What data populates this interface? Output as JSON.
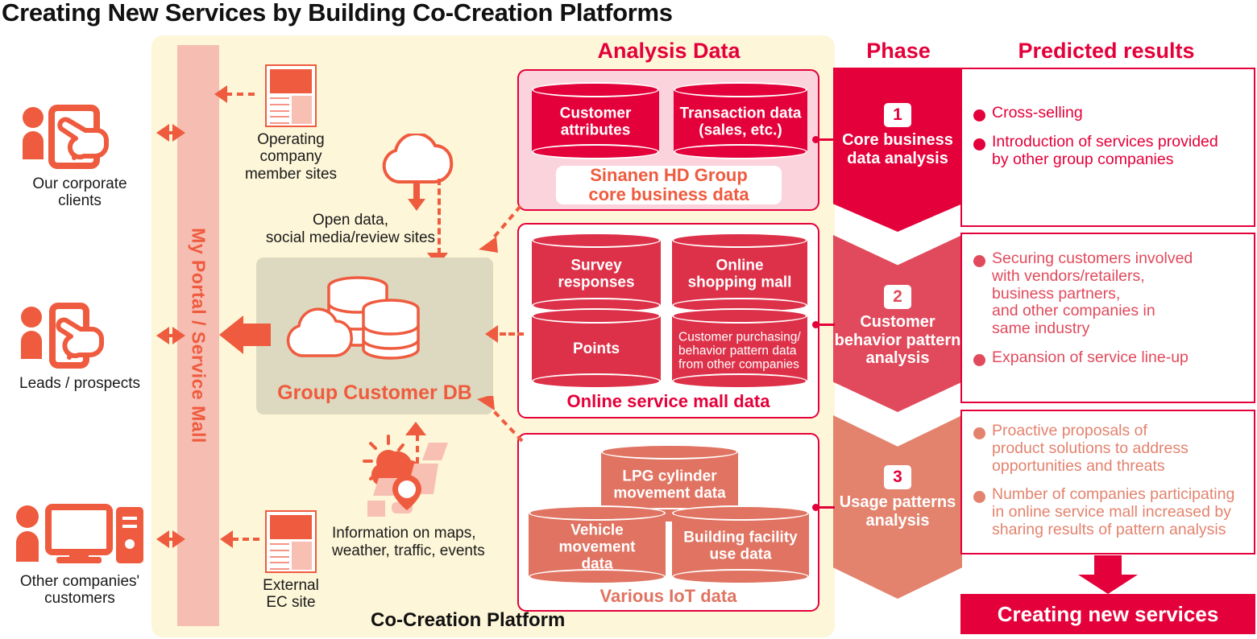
{
  "title": "Creating New Services by Building Co-Creation Platforms",
  "platform": {
    "label": "Co-Creation Platform",
    "portal_bar": "My Portal / Service Mall",
    "group_db": "Group Customer DB",
    "notes": {
      "open_data": "Open data,\nsocial media/review sites",
      "map_info": "Information on maps,\nweather, traffic, events"
    },
    "thumbs": [
      {
        "name": "operating-company-member-sites",
        "caption": "Operating company\nmember sites"
      },
      {
        "name": "external-ec-site",
        "caption": "External\nEC site"
      }
    ]
  },
  "personas": [
    {
      "name": "our-corporate-clients",
      "caption": "Our corporate\nclients",
      "icon": "person-tablet-tap-icon"
    },
    {
      "name": "leads-prospects",
      "caption": "Leads / prospects",
      "icon": "person-smartphone-tap-icon"
    },
    {
      "name": "other-companies-customers",
      "caption": "Other companies'\ncustomers",
      "icon": "person-desktop-pc-icon"
    }
  ],
  "analysis": {
    "heading": "Analysis Data",
    "groups": [
      {
        "name": "core-business-data",
        "caption": "Sinanen HD Group\ncore business data",
        "caption_style": "white-pill",
        "cylinders": [
          {
            "label": "Customer\nattributes"
          },
          {
            "label": "Transaction data\n(sales, etc.)"
          }
        ]
      },
      {
        "name": "online-service-mall-data",
        "caption": "Online service mall data",
        "caption_style": "plain",
        "cylinders": [
          {
            "label": "Survey\nresponses"
          },
          {
            "label": "Online\nshopping mall"
          },
          {
            "label": "Points"
          },
          {
            "label": "Customer purchasing/\nbehavior  pattern data\nfrom other companies"
          }
        ]
      },
      {
        "name": "various-iot-data",
        "caption": "Various IoT data",
        "caption_style": "plain",
        "cylinders": [
          {
            "label": "LPG cylinder\nmovement data"
          },
          {
            "label": "Vehicle movement\ndata"
          },
          {
            "label": "Building facility\nuse data"
          }
        ]
      }
    ]
  },
  "phase": {
    "heading": "Phase",
    "items": [
      {
        "number": "1",
        "label": "Core business\ndata analysis",
        "color": "#e4003a"
      },
      {
        "number": "2",
        "label": "Customer\nbehavior pattern\nanalysis",
        "color": "#e14a5c"
      },
      {
        "number": "3",
        "label": "Usage patterns\nanalysis",
        "color": "#e3836e"
      }
    ]
  },
  "results": {
    "heading": "Predicted results",
    "boxes": [
      {
        "name": "predicted-results-phase-1",
        "color": "#e4003a",
        "items": [
          "Cross-selling",
          "Introduction of services provided\nby other group companies"
        ]
      },
      {
        "name": "predicted-results-phase-2",
        "color": "#e14a5c",
        "items": [
          "Securing customers involved\nwith vendors/retailers,\nbusiness partners,\nand other companies in\nsame industry",
          "Expansion of service line-up"
        ]
      },
      {
        "name": "predicted-results-phase-3",
        "color": "#e3836e",
        "items": [
          "Proactive proposals of\nproduct solutions to address\nopportunities and threats",
          "Number of companies participating\nin online service mall increased by\nsharing results of pattern analysis"
        ]
      }
    ],
    "outcome": "Creating new services"
  },
  "colors": {
    "brand_red": "#e4003a",
    "orange": "#ef5b3e",
    "pink_panel": "#fbd3dd",
    "yellow_panel": "#fdf6d8",
    "portal_pink": "#f6beb3",
    "db_grey": "#ddd9c0"
  }
}
